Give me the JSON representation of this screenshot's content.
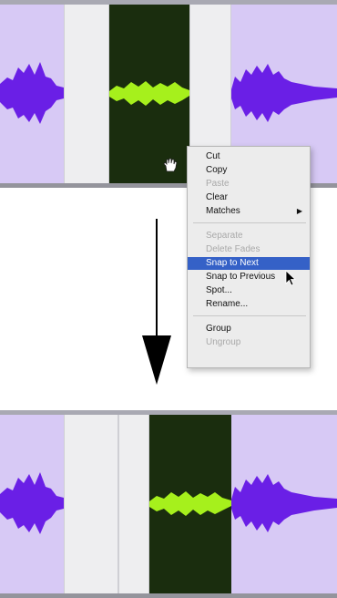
{
  "context_menu": {
    "items": [
      {
        "label": "Cut",
        "enabled": true
      },
      {
        "label": "Copy",
        "enabled": true
      },
      {
        "label": "Paste",
        "enabled": false
      },
      {
        "label": "Clear",
        "enabled": true
      },
      {
        "label": "Matches",
        "enabled": true,
        "submenu_glyph": "▶"
      },
      {
        "label": "Separate",
        "enabled": false
      },
      {
        "label": "Delete Fades",
        "enabled": false
      },
      {
        "label": "Snap to Next",
        "enabled": true,
        "highlighted": true
      },
      {
        "label": "Snap to Previous",
        "enabled": true
      },
      {
        "label": "Spot...",
        "enabled": true
      },
      {
        "label": "Rename...",
        "enabled": true
      },
      {
        "label": "Group",
        "enabled": true
      },
      {
        "label": "Ungroup",
        "enabled": false
      }
    ],
    "highlight_color": "#3561c7"
  },
  "colors": {
    "clip_background": "#d7c9f5",
    "waveform_purple": "#6a1fe6",
    "selected_clip_background": "#1a2d0e",
    "waveform_green": "#a6f01c",
    "gap": "#eeeef0"
  },
  "icons": [
    "hand-cursor-icon",
    "arrow-pointer-icon",
    "down-arrow-icon",
    "chevron-right-icon"
  ]
}
